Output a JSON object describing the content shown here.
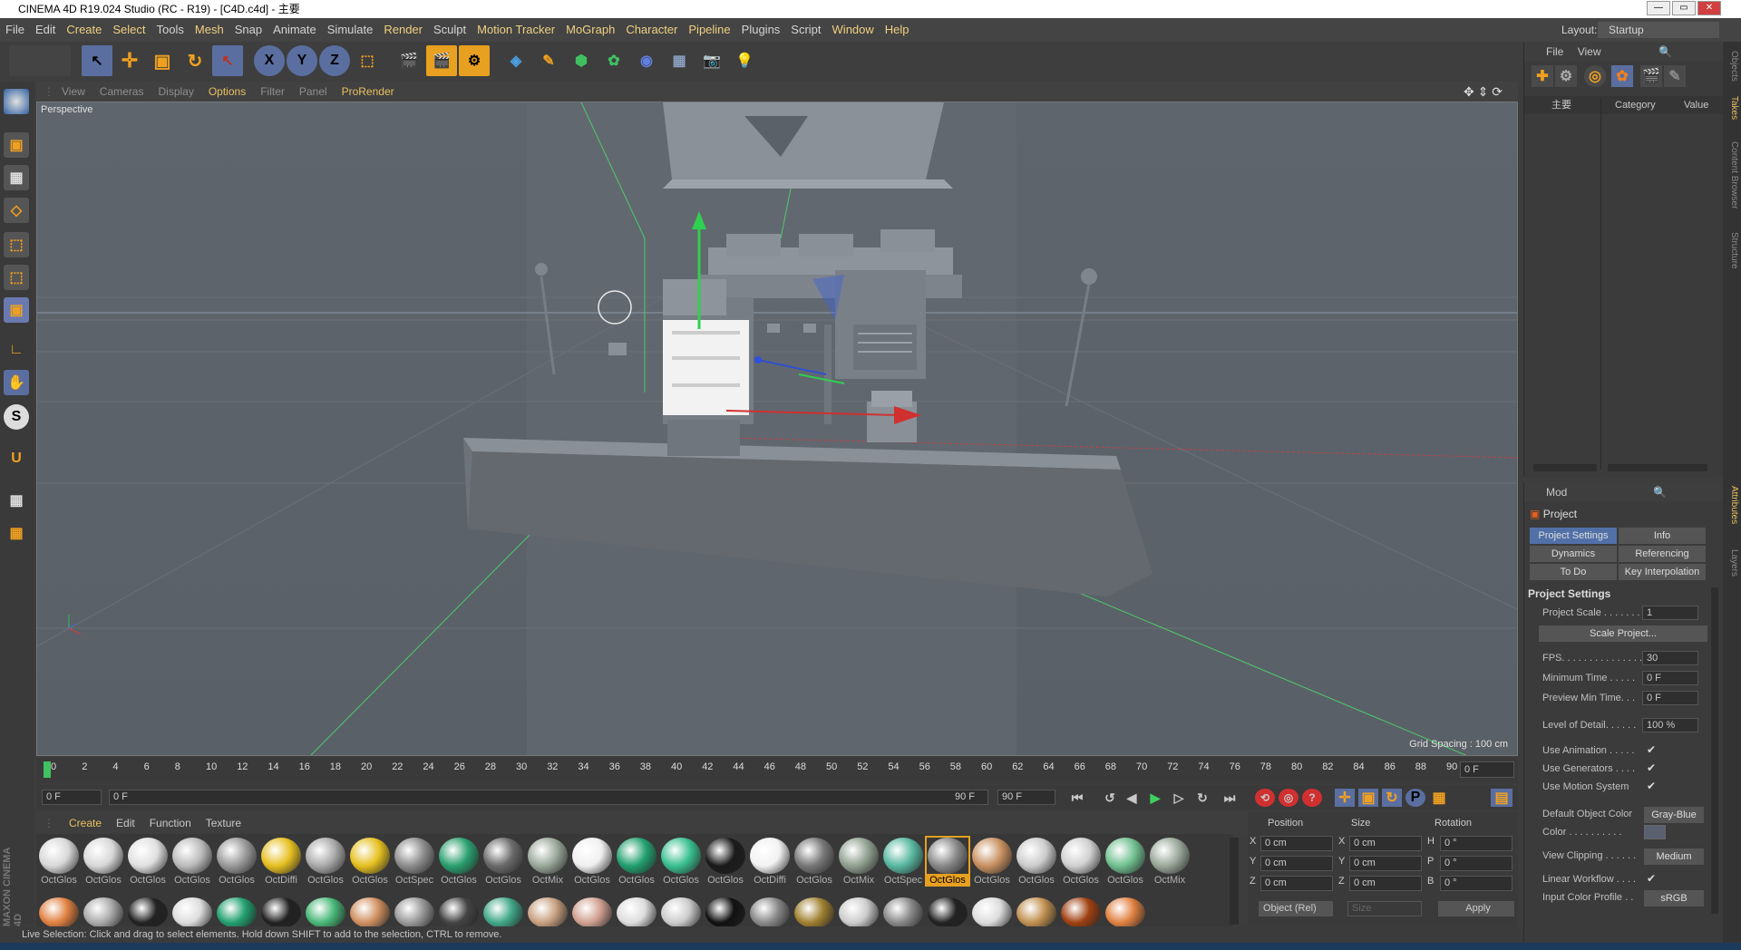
{
  "window": {
    "title": "CINEMA 4D R19.024 Studio (RC - R19) - [C4D.c4d] - 主要",
    "layout_label": "Layout:",
    "layout_value": "Startup"
  },
  "menu": [
    "File",
    "Edit",
    "Create",
    "Select",
    "Tools",
    "Mesh",
    "Snap",
    "Animate",
    "Simulate",
    "Render",
    "Sculpt",
    "Motion Tracker",
    "MoGraph",
    "Character",
    "Pipeline",
    "Plugins",
    "Script",
    "Window",
    "Help"
  ],
  "viewport": {
    "menu": [
      "View",
      "Cameras",
      "Display",
      "Options",
      "Filter",
      "Panel",
      "ProRender"
    ],
    "active_menu": "Options",
    "camera_label": "Perspective",
    "grid_spacing": "Grid Spacing : 100 cm"
  },
  "toolbar": {
    "axis_x": "X",
    "axis_y": "Y",
    "axis_z": "Z"
  },
  "timeline": {
    "ticks": [
      "0",
      "2",
      "4",
      "6",
      "8",
      "10",
      "12",
      "14",
      "16",
      "18",
      "20",
      "22",
      "24",
      "26",
      "28",
      "30",
      "32",
      "34",
      "36",
      "38",
      "40",
      "42",
      "44",
      "46",
      "48",
      "50",
      "52",
      "54",
      "56",
      "58",
      "60",
      "62",
      "64",
      "66",
      "68",
      "70",
      "72",
      "74",
      "76",
      "78",
      "80",
      "82",
      "84",
      "86",
      "88",
      "90"
    ],
    "end_field": "0 F"
  },
  "transport": {
    "current": "0 F",
    "range_start": "0 F",
    "range_end": "90 F",
    "max": "90 F"
  },
  "materials": {
    "menu": [
      "Create",
      "Edit",
      "Function",
      "Texture"
    ],
    "row1": [
      "OctGlos",
      "OctGlos",
      "OctGlos",
      "OctGlos",
      "OctGlos",
      "OctDiffi",
      "OctGlos",
      "OctGlos",
      "OctSpec",
      "OctGlos",
      "OctGlos",
      "OctMix",
      "OctGlos",
      "OctGlos",
      "OctGlos",
      "OctGlos",
      "OctDiffi",
      "OctGlos",
      "OctMix",
      "OctSpec",
      "OctGlos",
      "OctGlos",
      "OctGlos",
      "OctGlos",
      "OctGlos",
      "OctMix"
    ],
    "selected_index": 20,
    "row1_colors": [
      "#d8d8d8",
      "#d8d8d8",
      "#e0e0e0",
      "#bbbbbb",
      "#999999",
      "#e6c020",
      "#aaaaaa",
      "#e6c020",
      "#8c8c8c",
      "#2aa070",
      "#6a6a6a",
      "#9aa89a",
      "#f0f0f0",
      "#22a070",
      "#38c090",
      "#1a1a1a",
      "#f2f2f2",
      "#777777",
      "#90a090",
      "#58b8a0",
      "#888888",
      "#c89060",
      "#cccccc",
      "#d0d0d0",
      "#70c090",
      "#9aa89a"
    ],
    "row2_colors": [
      "#e08040",
      "#aaaaaa",
      "#222222",
      "#dddddd",
      "#22a070",
      "#222222",
      "#48b878",
      "#d09060",
      "#999999",
      "#444444",
      "#40a888",
      "#c8a080",
      "#d0a090",
      "#dddddd",
      "#cccccc",
      "#111111",
      "#888888",
      "#a08030",
      "#cccccc",
      "#888888",
      "#222222",
      "#dddddd",
      "#c09050",
      "#a04010",
      "#e08040"
    ]
  },
  "coords": {
    "position_header": "Position",
    "size_header": "Size",
    "rotation_header": "Rotation",
    "rows": [
      {
        "axis": "X",
        "pos": "0 cm",
        "saxis": "X",
        "size": "0 cm",
        "raxis": "H",
        "rot": "0 °"
      },
      {
        "axis": "Y",
        "pos": "0 cm",
        "saxis": "Y",
        "size": "0 cm",
        "raxis": "P",
        "rot": "0 °"
      },
      {
        "axis": "Z",
        "pos": "0 cm",
        "saxis": "Z",
        "size": "0 cm",
        "raxis": "B",
        "rot": "0 °"
      }
    ],
    "mode": "Object (Rel)",
    "size_mode": "Size",
    "apply": "Apply"
  },
  "status": "Live Selection: Click and drag to select elements. Hold down SHIFT to add to the selection, CTRL to remove.",
  "objects": {
    "menu": [
      "File",
      "View"
    ],
    "col_name": "主要",
    "col_category": "Category",
    "col_value": "Value"
  },
  "attributes": {
    "mode": "Mod",
    "title": "Project",
    "tabs": [
      "Project Settings",
      "Info",
      "Dynamics",
      "Referencing",
      "To Do",
      "Key Interpolation"
    ],
    "section": "Project Settings",
    "project_scale_label": "Project Scale . . . . . . .",
    "project_scale": "1",
    "scale_project_btn": "Scale Project...",
    "fps_label": "FPS. . . . . . . . . . . . . . .",
    "fps": "30",
    "min_time_label": "Minimum Time . . . . .",
    "min_time": "0 F",
    "preview_min_label": "Preview Min Time. . .",
    "preview_min": "0 F",
    "lod_label": "Level of Detail. . . . . .",
    "lod": "100 %",
    "use_anim": "Use Animation . . . . .",
    "use_gen": "Use Generators . . . .",
    "use_motion": "Use Motion System",
    "default_color_label": "Default Object Color",
    "default_color": "Gray-Blue",
    "color_label": "Color . . . . . . . . . .",
    "view_clip_label": "View Clipping . . . . . .",
    "view_clip": "Medium",
    "linear_label": "Linear Workflow . . . .",
    "input_profile_label": "Input Color Profile . .",
    "input_profile": "sRGB"
  },
  "side_tabs": [
    "Objects",
    "Takes",
    "Content Browser",
    "Structure",
    "Attributes",
    "Layers"
  ]
}
